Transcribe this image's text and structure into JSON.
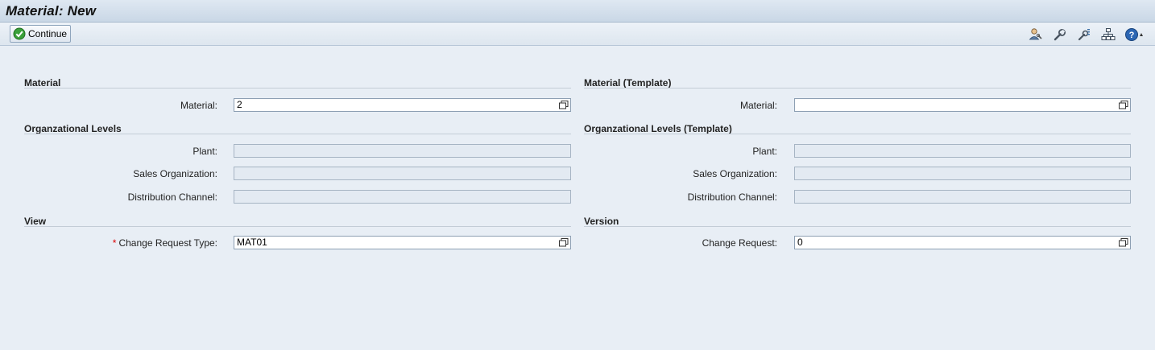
{
  "window": {
    "title": "Material: New"
  },
  "toolbar": {
    "continue_label": "Continue"
  },
  "left": {
    "material_section": {
      "title": "Material",
      "material_label": "Material:",
      "material_value": "2"
    },
    "org_section": {
      "title": "Organzational Levels",
      "plant_label": "Plant:",
      "plant_value": "",
      "sales_org_label": "Sales Organization:",
      "sales_org_value": "",
      "dist_channel_label": "Distribution Channel:",
      "dist_channel_value": ""
    },
    "view_section": {
      "title": "View",
      "required_marker": "*",
      "cr_type_label": "Change Request Type:",
      "cr_type_value": "MAT01"
    }
  },
  "right": {
    "material_section": {
      "title": "Material (Template)",
      "material_label": "Material:",
      "material_value": ""
    },
    "org_section": {
      "title": "Organzational Levels (Template)",
      "plant_label": "Plant:",
      "plant_value": "",
      "sales_org_label": "Sales Organization:",
      "sales_org_value": "",
      "dist_channel_label": "Distribution Channel:",
      "dist_channel_value": ""
    },
    "version_section": {
      "title": "Version",
      "change_request_label": "Change Request:",
      "change_request_value": "0"
    }
  },
  "toolbar_icons": [
    "user-settings-icon",
    "wrench-icon",
    "customize-icon",
    "hierarchy-icon",
    "help-icon"
  ],
  "colors": {
    "required": "#dd0000",
    "background": "#e8eef5"
  }
}
